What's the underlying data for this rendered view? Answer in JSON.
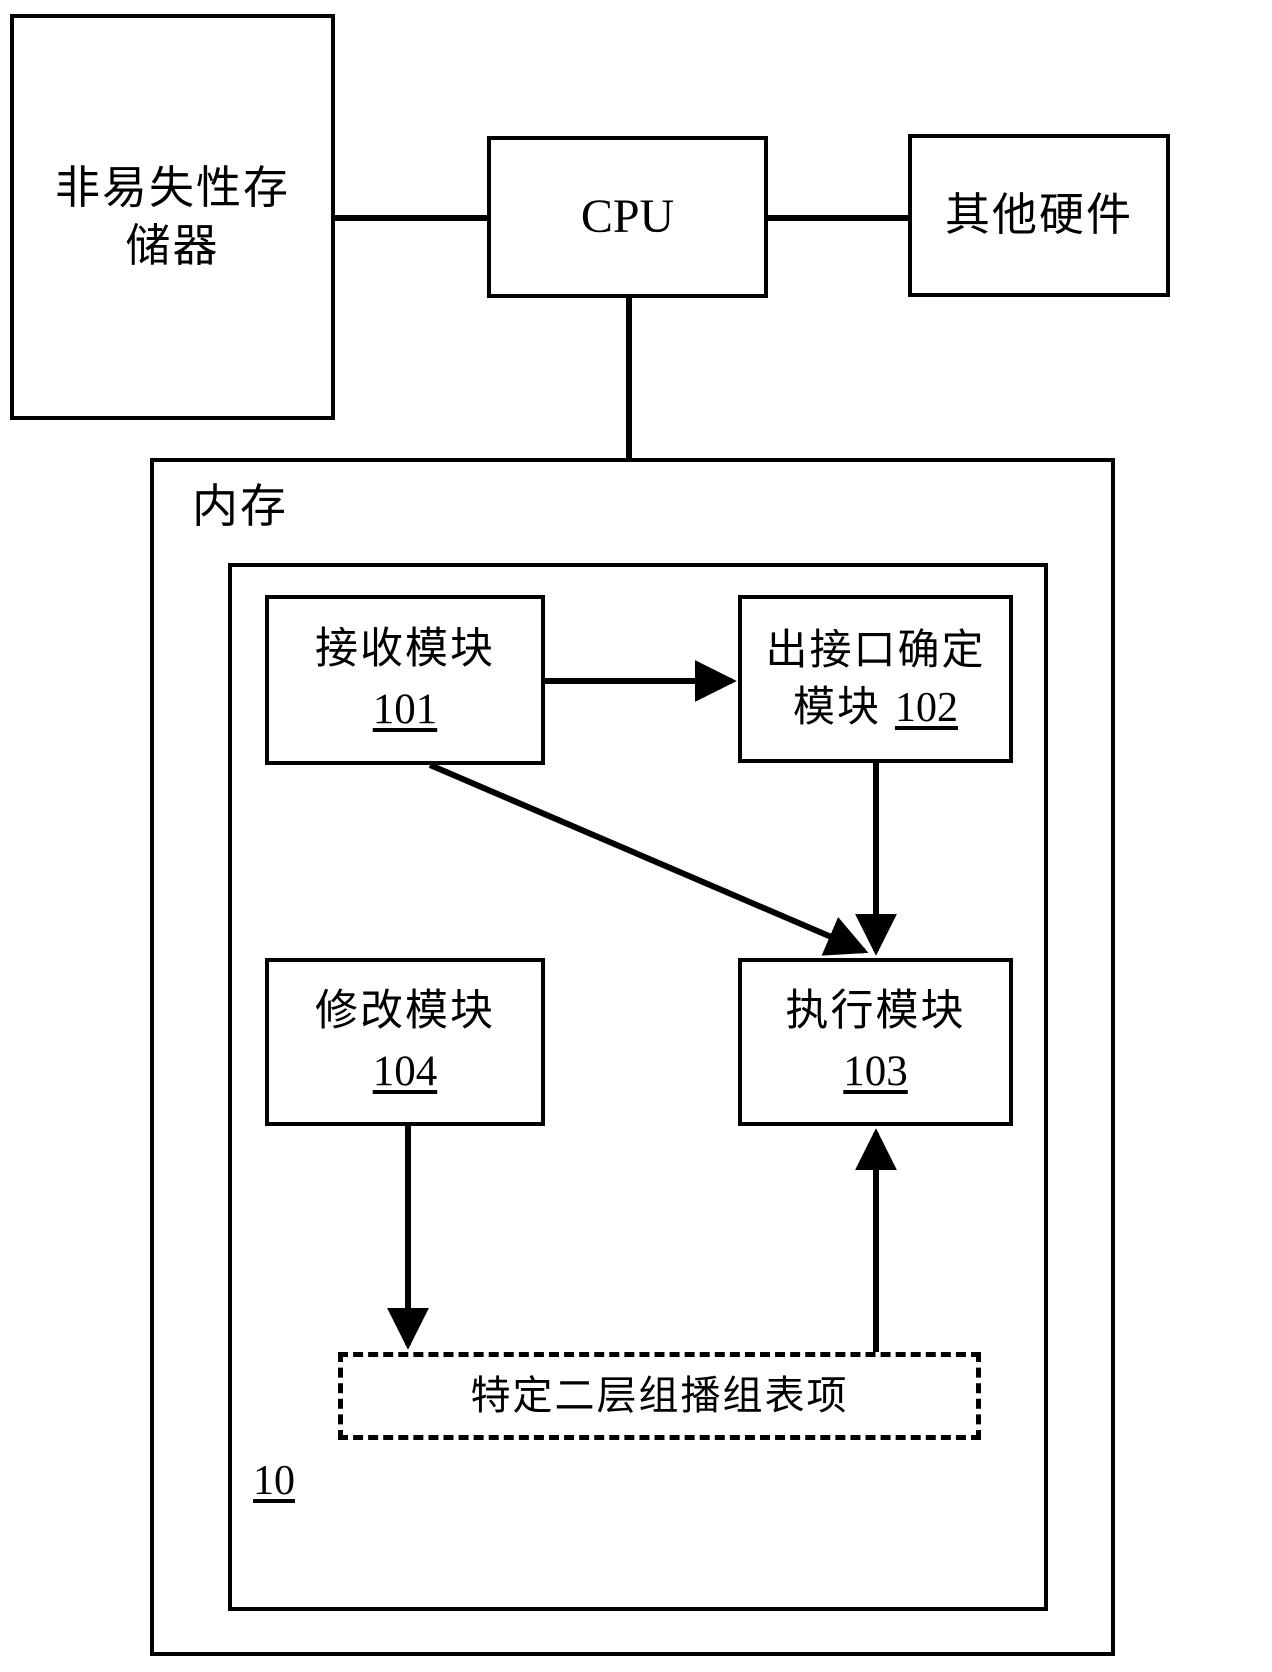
{
  "figure": {
    "type": "block-diagram",
    "language": "zh-CN",
    "stroke_color": "#000000",
    "background_color": "#ffffff"
  },
  "nodes": {
    "nonvolatile_storage": {
      "label": "非易失性存\n储器",
      "shape": "rectangle"
    },
    "cpu": {
      "label": "CPU",
      "shape": "rectangle"
    },
    "other_hardware": {
      "label": "其他硬件",
      "shape": "rectangle"
    },
    "memory": {
      "label": "内存",
      "shape": "rectangle"
    },
    "device": {
      "label": "10",
      "shape": "rectangle"
    },
    "receive_module": {
      "name": "接收模块",
      "number": "101",
      "shape": "rectangle"
    },
    "egress_interface_module": {
      "name": "出接口确定",
      "name_line2": "模块",
      "number": "102",
      "shape": "rectangle"
    },
    "execute_module": {
      "name": "执行模块",
      "number": "103",
      "shape": "rectangle"
    },
    "modify_module": {
      "name": "修改模块",
      "number": "104",
      "shape": "rectangle"
    },
    "multicast_table_entry": {
      "label": "特定二层组播组表项",
      "shape": "dashed-rectangle"
    }
  },
  "edges": [
    {
      "from": "nonvolatile_storage",
      "to": "cpu",
      "style": "line"
    },
    {
      "from": "cpu",
      "to": "other_hardware",
      "style": "line"
    },
    {
      "from": "cpu",
      "to": "memory",
      "style": "line"
    },
    {
      "from": "receive_module",
      "to": "egress_interface_module",
      "style": "arrow"
    },
    {
      "from": "receive_module",
      "to": "execute_module",
      "style": "arrow"
    },
    {
      "from": "egress_interface_module",
      "to": "execute_module",
      "style": "arrow"
    },
    {
      "from": "modify_module",
      "to": "multicast_table_entry",
      "style": "arrow"
    },
    {
      "from": "multicast_table_entry",
      "to": "execute_module",
      "style": "arrow"
    }
  ]
}
